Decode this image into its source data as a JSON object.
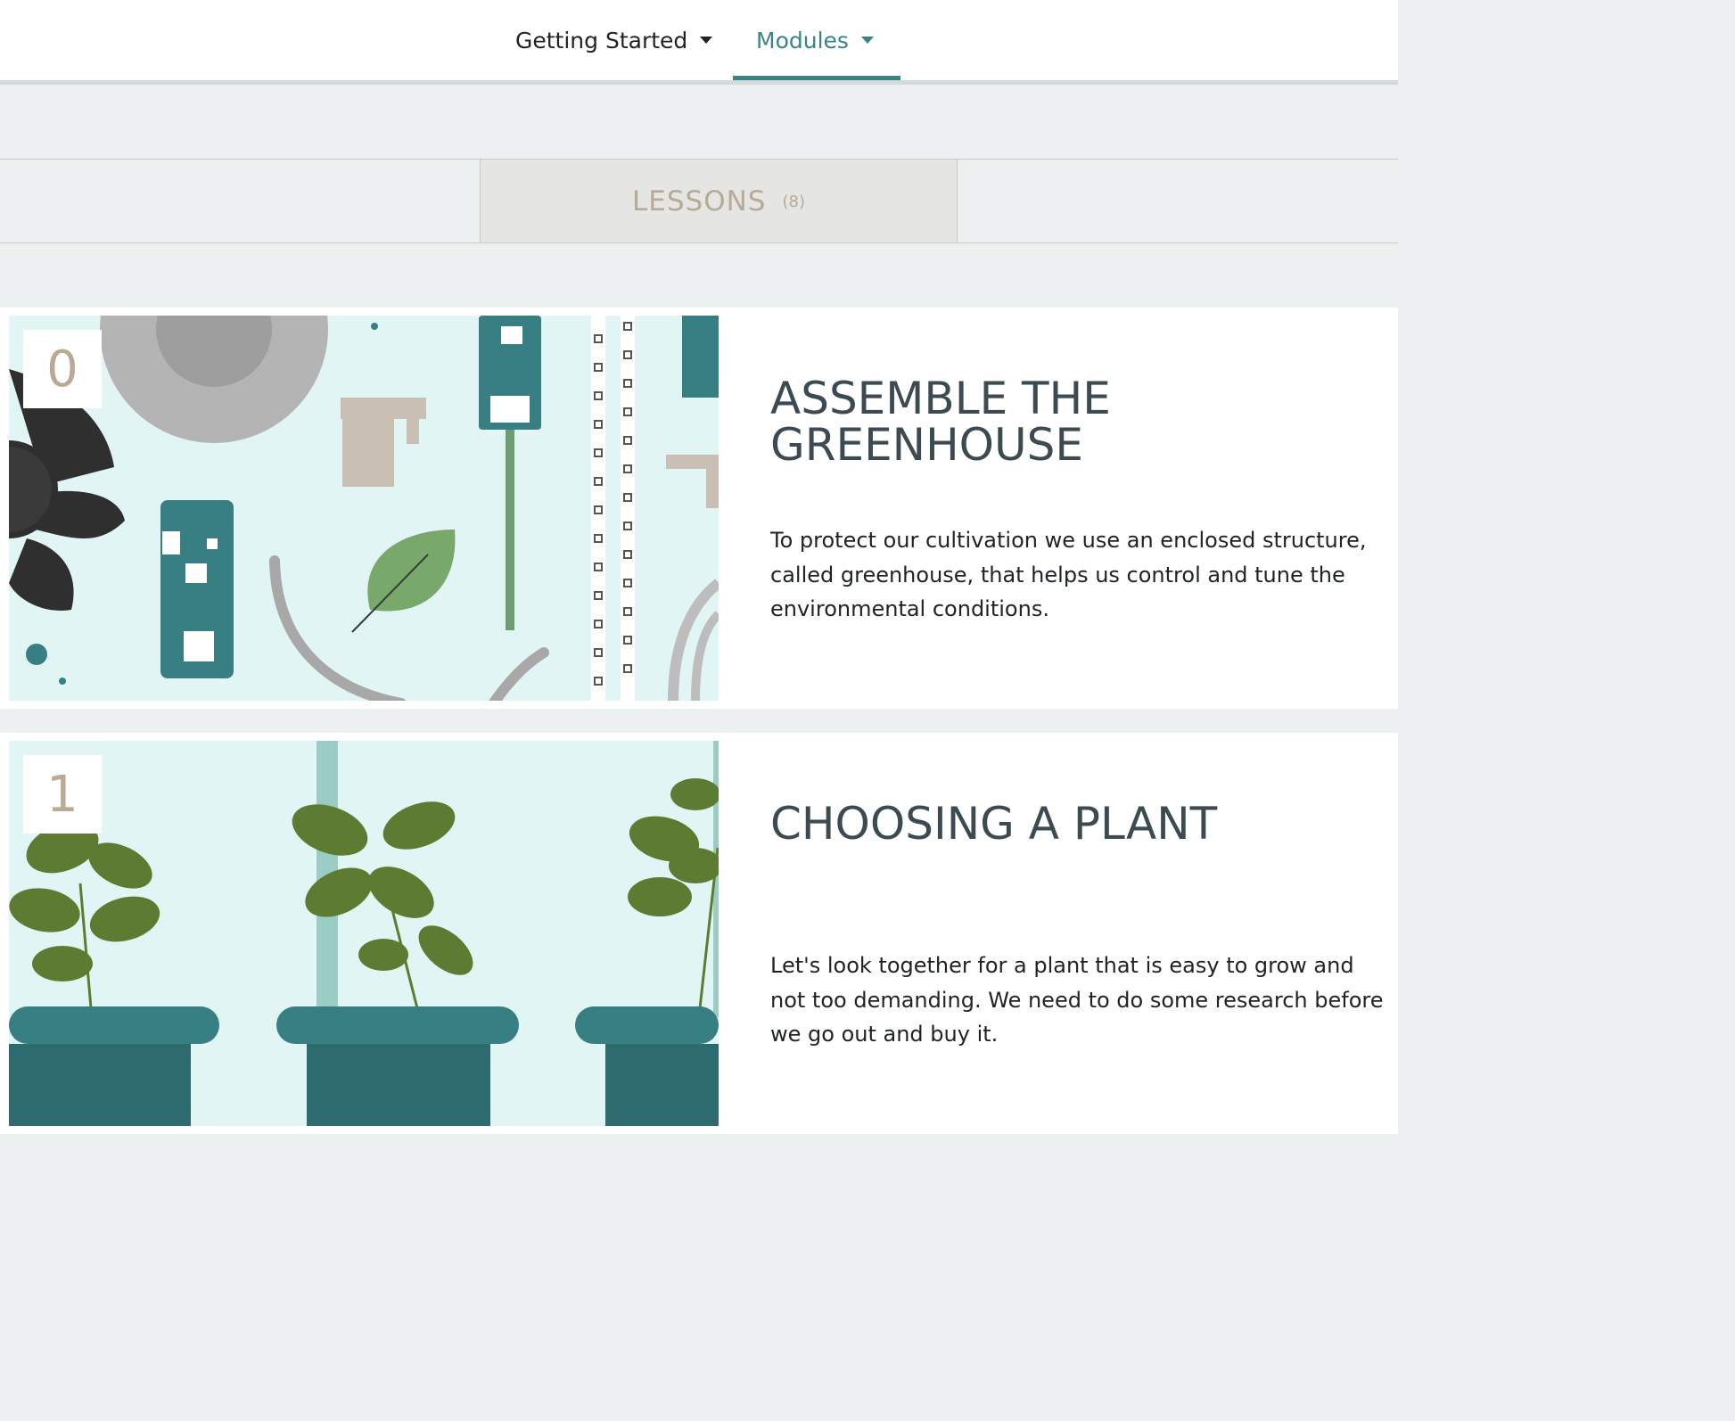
{
  "nav": {
    "items": [
      {
        "label": "Getting Started",
        "active": false
      },
      {
        "label": "Modules",
        "active": true
      }
    ]
  },
  "tabs": {
    "lessons_label": "LESSONS",
    "lessons_count": "(8)"
  },
  "lessons": [
    {
      "number": "0",
      "title": "ASSEMBLE THE GREENHOUSE",
      "description": "To protect our cultivation we use an enclosed structure, called greenhouse, that helps us control and tune the environmental conditions."
    },
    {
      "number": "1",
      "title": "CHOOSING A PLANT",
      "description": "Let's look together for a plant that is easy to grow and not too demanding. We need to do some research before we go out and buy it."
    }
  ],
  "colors": {
    "accent": "#3a8487",
    "page_bg": "#ecf0f0",
    "tab_text": "#b8aa96",
    "heading": "#3c4a52"
  },
  "icons": {
    "nav_caret": "caret-down-icon"
  }
}
